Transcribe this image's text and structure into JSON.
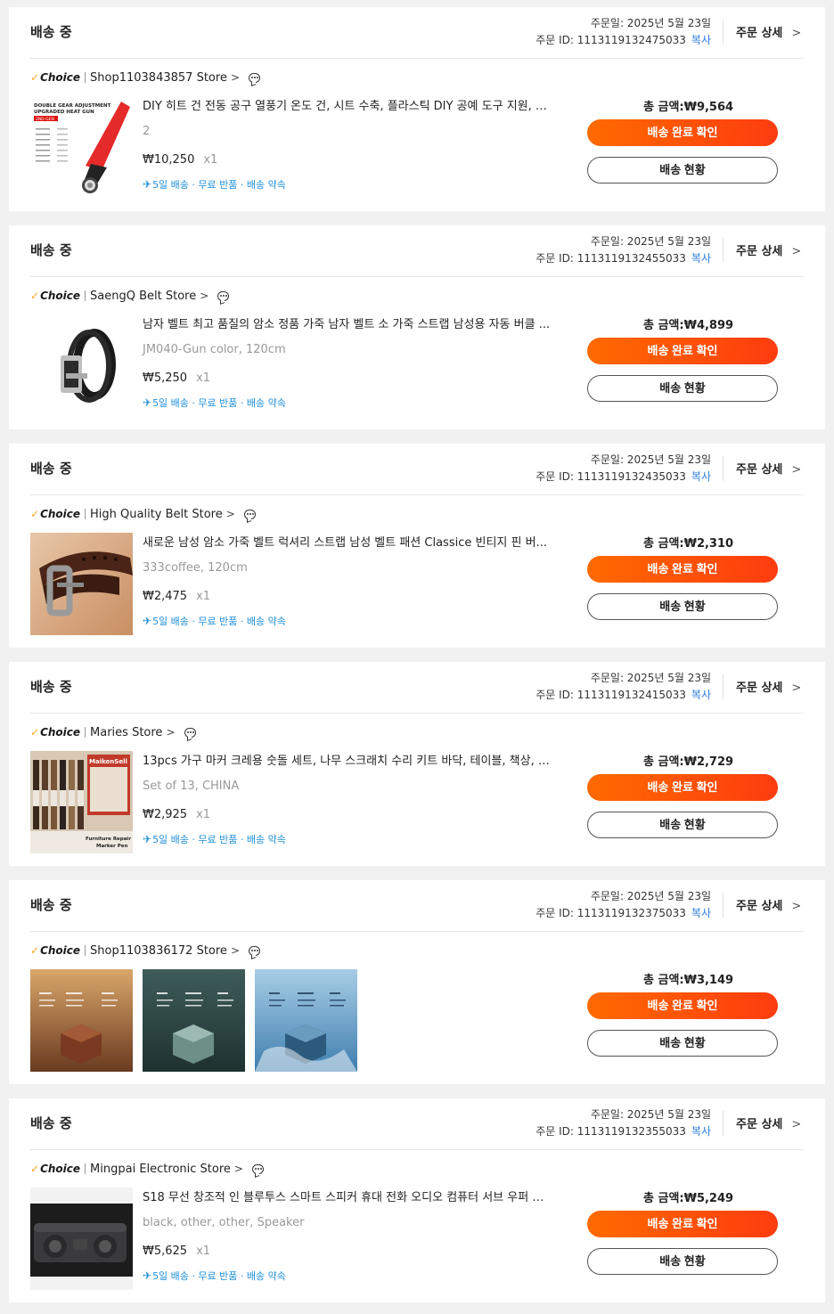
{
  "orders": [
    {
      "status": "배송 중",
      "order_date": "주문일: 2025년 5월 23일",
      "order_id": "주문 ID: 1113119132475033",
      "copy_label": "복사",
      "detail_label": "주문 상세",
      "choice_label": "Choice",
      "store": "Shop1103843857 Store",
      "title": "DIY 히트 건 전동 공구 열풍기 온도 건, 시트 수축, 플라스틱 DIY 공예 도구 지원, 2...",
      "variant": "2",
      "price": "₩10,250",
      "qty": "x1",
      "shipping": "5일 배송 · 무료 반품 · 배송 약속",
      "total": "총 금액:₩9,564",
      "confirm_label": "배송 완료 확인",
      "track_label": "배송 현황",
      "heat_gun_text_1": "DOUBLE GEAR ADJUSTMENT",
      "heat_gun_text_2": "UPGRADED HEAT GUN",
      "heat_gun_badge": "2ND GEN"
    },
    {
      "status": "배송 중",
      "order_date": "주문일: 2025년 5월 23일",
      "order_id": "주문 ID: 1113119132455033",
      "copy_label": "복사",
      "detail_label": "주문 상세",
      "choice_label": "Choice",
      "store": "SaengQ Belt Store",
      "title": "남자 벨트 최고 품질의 암소 정품 가죽 남자 벨트 소 가죽 스트랩 남성용 자동 버클 ...",
      "variant": "JM040-Gun color, 120cm",
      "price": "₩5,250",
      "qty": "x1",
      "shipping": "5일 배송 · 무료 반품 · 배송 약속",
      "total": "총 금액:₩4,899",
      "confirm_label": "배송 완료 확인",
      "track_label": "배송 현황"
    },
    {
      "status": "배송 중",
      "order_date": "주문일: 2025년 5월 23일",
      "order_id": "주문 ID: 1113119132435033",
      "copy_label": "복사",
      "detail_label": "주문 상세",
      "choice_label": "Choice",
      "store": "High Quality Belt Store",
      "title": "새로운 남성 암소 가죽 벨트 럭셔리 스트랩 남성 벨트 패션 Classice 빈티지 핀 버...",
      "variant": "333coffee, 120cm",
      "price": "₩2,475",
      "qty": "x1",
      "shipping": "5일 배송 · 무료 반품 · 배송 약속",
      "total": "총 금액:₩2,310",
      "confirm_label": "배송 완료 확인",
      "track_label": "배송 현황"
    },
    {
      "status": "배송 중",
      "order_date": "주문일: 2025년 5월 23일",
      "order_id": "주문 ID: 1113119132415033",
      "copy_label": "복사",
      "detail_label": "주문 상세",
      "choice_label": "Choice",
      "store": "Maries Store",
      "title": "13pcs 가구 마커 크레용 숫돌 세트, 나무 스크래치 수리 키트 바닥, 테이블, 책상, 얼...",
      "variant": "Set of 13, CHINA",
      "price": "₩2,925",
      "qty": "x1",
      "shipping": "5일 배송 · 무료 반품 · 배송 약속",
      "total": "총 금액:₩2,729",
      "confirm_label": "배송 완료 확인",
      "track_label": "배송 현황",
      "marker_text_1": "MaikenSell",
      "marker_text_2": "Furniture Repair",
      "marker_text_3": "Marker Pen"
    },
    {
      "status": "배송 중",
      "order_date": "주문일: 2025년 5월 23일",
      "order_id": "주문 ID: 1113119132375033",
      "copy_label": "복사",
      "detail_label": "주문 상세",
      "choice_label": "Choice",
      "store": "Shop1103836172 Store",
      "total": "총 금액:₩3,149",
      "confirm_label": "배송 완료 확인",
      "track_label": "배송 현황"
    },
    {
      "status": "배송 중",
      "order_date": "주문일: 2025년 5월 23일",
      "order_id": "주문 ID: 1113119132355033",
      "copy_label": "복사",
      "detail_label": "주문 상세",
      "choice_label": "Choice",
      "store": "Mingpai Electronic Store",
      "title": "S18 무선 창조적 인 블루투스 스마트 스피커 휴대 전화 오디오 컴퓨터 서브 우퍼 야...",
      "variant": "black, other, other, Speaker",
      "price": "₩5,625",
      "qty": "x1",
      "shipping": "5일 배송 · 무료 반품 · 배송 약속",
      "total": "총 금액:₩5,249",
      "confirm_label": "배송 완료 확인",
      "track_label": "배송 현황"
    }
  ],
  "colors": {
    "accent_orange": "#fd5a0a",
    "link_blue": "#2d7de0",
    "ship_blue": "#1f8fd8",
    "choice_check": "#f5a623"
  },
  "icons": {
    "chat": "chat-bubble-icon",
    "chevron": "chevron-right-icon",
    "plane": "plane-icon"
  }
}
